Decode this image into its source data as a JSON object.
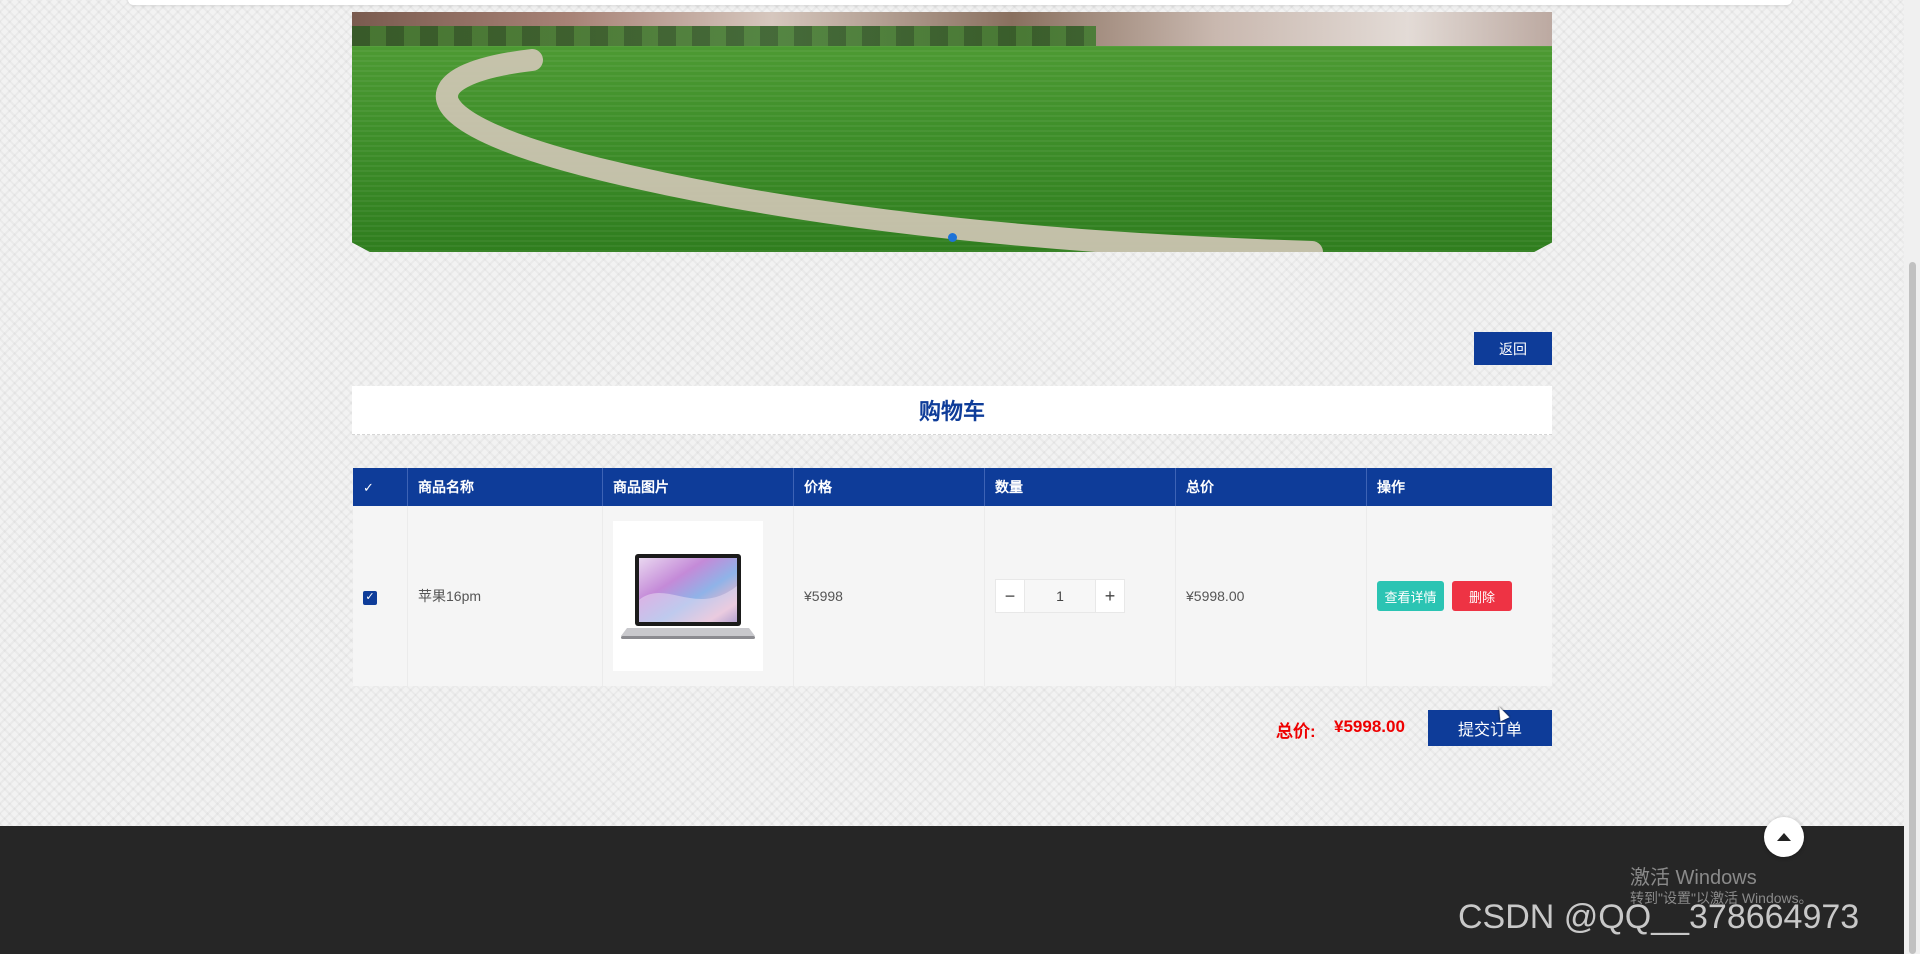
{
  "banner": {
    "slide_count": 1,
    "active_slide": 1
  },
  "return_button": {
    "label": "返回"
  },
  "cart": {
    "title": "购物车",
    "columns": [
      "✓",
      "商品名称",
      "商品图片",
      "价格",
      "数量",
      "总价",
      "操作"
    ],
    "rows": [
      {
        "selected": true,
        "name": "苹果16pm",
        "image": "laptop",
        "price": "¥5998",
        "quantity": "1",
        "total": "¥5998.00",
        "detail_label": "查看详情",
        "delete_label": "删除"
      }
    ],
    "minus": "−",
    "plus": "+",
    "total_label": "总价:",
    "total_value": "¥5998.00",
    "submit_label": "提交订单"
  },
  "watermark": {
    "activate_title": "激活 Windows",
    "activate_sub": "转到\"设置\"以激活 Windows。",
    "csdn": "CSDN @QQ__378664973"
  },
  "colors": {
    "primary": "#0e3c99",
    "danger": "#ee3344",
    "detail": "#2bc4b3",
    "price": "#ee0000",
    "footer": "#262626"
  },
  "icons": [
    "checkbox-icon",
    "minus-icon",
    "plus-icon",
    "back-to-top-icon"
  ]
}
